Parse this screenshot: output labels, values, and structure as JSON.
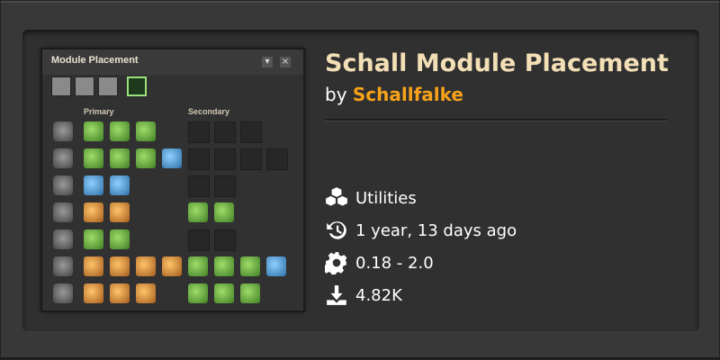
{
  "mod": {
    "title": "Schall Module Placement",
    "by_prefix": "by",
    "author": "Schallfalke",
    "category": {
      "icon": "cubes-icon",
      "label": "Utilities"
    },
    "updated": {
      "icon": "history-icon",
      "label": "1 year, 13 days ago"
    },
    "versions": {
      "icon": "gear-icon",
      "label": "0.18 - 2.0"
    },
    "downloads": {
      "icon": "download-icon",
      "label": "4.82K"
    }
  },
  "thumbnail": {
    "window_title": "Module Placement",
    "col_primary": "Primary",
    "col_secondary": "Secondary"
  },
  "colors": {
    "title": "#f3dfb6",
    "author": "#f7a21a",
    "background": "#383838"
  }
}
